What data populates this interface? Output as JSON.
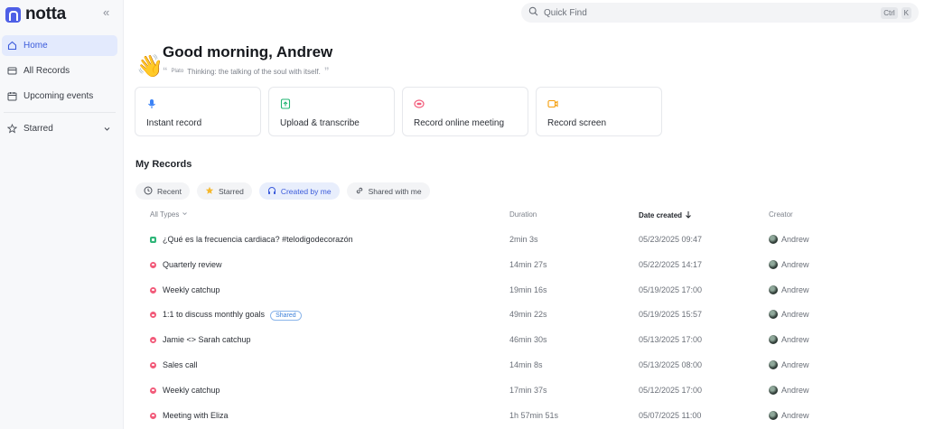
{
  "app": {
    "name": "notta"
  },
  "sidebar": {
    "collapse_label": "«",
    "items": [
      {
        "label": "Home",
        "icon": "home-icon",
        "active": true
      },
      {
        "label": "All Records",
        "icon": "folder-icon",
        "active": false
      },
      {
        "label": "Upcoming events",
        "icon": "calendar-icon",
        "active": false
      }
    ],
    "starred": {
      "label": "Starred",
      "icon": "star-icon"
    }
  },
  "search": {
    "placeholder": "Quick Find",
    "shortcut_mod": "Ctrl",
    "shortcut_key": "K"
  },
  "greeting": {
    "title": "Good morning, Andrew",
    "quote_author": "Plato",
    "quote": "Thinking: the talking of the soul with itself."
  },
  "actions": [
    {
      "label": "Instant record",
      "icon": "microphone-icon",
      "color": "#3b82f6"
    },
    {
      "label": "Upload & transcribe",
      "icon": "upload-icon",
      "color": "#22b573"
    },
    {
      "label": "Record online meeting",
      "icon": "meeting-icon",
      "color": "#f25b7a"
    },
    {
      "label": "Record screen",
      "icon": "screen-record-icon",
      "color": "#f59e0b"
    }
  ],
  "records": {
    "title": "My Records",
    "filters": [
      {
        "label": "Recent",
        "icon": "clock-icon",
        "active": false
      },
      {
        "label": "Starred",
        "icon": "star-icon",
        "active": false
      },
      {
        "label": "Created by me",
        "icon": "headphones-icon",
        "active": true
      },
      {
        "label": "Shared with me",
        "icon": "link-icon",
        "active": false
      }
    ],
    "columns": {
      "type": "All Types",
      "duration": "Duration",
      "date": "Date created",
      "creator": "Creator"
    },
    "rows": [
      {
        "name": "¿Qué es la frecuencia cardiaca? #telodigodecorazón",
        "kind": "upload",
        "shared": false,
        "duration": "2min 3s",
        "date": "05/23/2025 09:47",
        "creator": "Andrew"
      },
      {
        "name": "Quarterly review",
        "kind": "meeting",
        "shared": false,
        "duration": "14min 27s",
        "date": "05/22/2025 14:17",
        "creator": "Andrew"
      },
      {
        "name": "Weekly catchup",
        "kind": "meeting",
        "shared": false,
        "duration": "19min 16s",
        "date": "05/19/2025 17:00",
        "creator": "Andrew"
      },
      {
        "name": "1:1 to discuss monthly goals",
        "kind": "meeting",
        "shared": true,
        "shared_label": "Shared",
        "duration": "49min 22s",
        "date": "05/19/2025 15:57",
        "creator": "Andrew"
      },
      {
        "name": "Jamie <> Sarah catchup",
        "kind": "meeting",
        "shared": false,
        "duration": "46min 30s",
        "date": "05/13/2025 17:00",
        "creator": "Andrew"
      },
      {
        "name": "Sales call",
        "kind": "meeting",
        "shared": false,
        "duration": "14min 8s",
        "date": "05/13/2025 08:00",
        "creator": "Andrew"
      },
      {
        "name": "Weekly catchup",
        "kind": "meeting",
        "shared": false,
        "duration": "17min 37s",
        "date": "05/12/2025 17:00",
        "creator": "Andrew"
      },
      {
        "name": "Meeting with Eliza",
        "kind": "meeting",
        "shared": false,
        "duration": "1h 57min 51s",
        "date": "05/07/2025 11:00",
        "creator": "Andrew"
      }
    ]
  }
}
